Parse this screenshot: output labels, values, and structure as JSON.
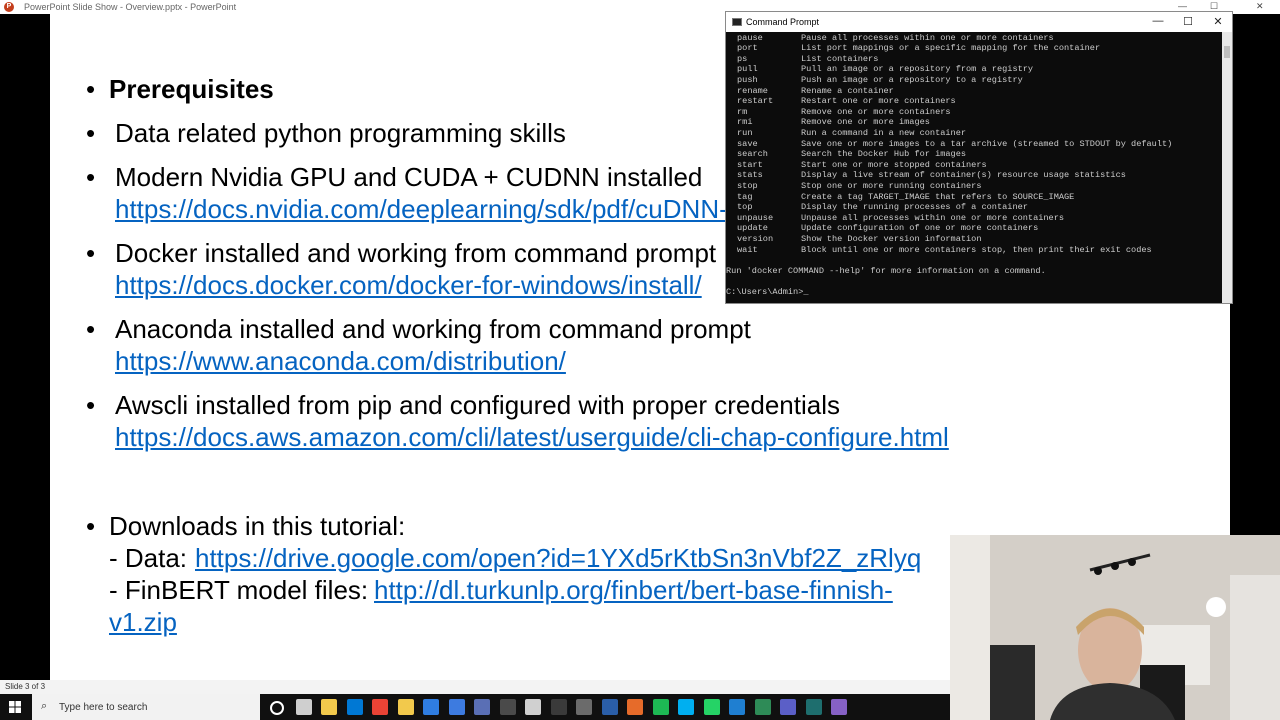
{
  "pp_titlebar": {
    "title": "PowerPoint Slide Show  -  Overview.pptx  -  PowerPoint",
    "minimize": "—",
    "maximize": "☐",
    "close": "✕"
  },
  "slide": {
    "prerequisites_heading": "Prerequisites",
    "items": [
      {
        "text": "Data related python programming skills"
      },
      {
        "text": "Modern Nvidia GPU and CUDA + CUDNN installed",
        "link": "https://docs.nvidia.com/deeplearning/sdk/pdf/cuDNN-Installation-Guide.pdf"
      },
      {
        "text": "Docker installed and working from command prompt",
        "link": "https://docs.docker.com/docker-for-windows/install/"
      },
      {
        "text": "Anaconda installed and working from command prompt",
        "link": "https://www.anaconda.com/distribution/"
      },
      {
        "text": "Awscli installed from pip and configured with proper credentials",
        "link": "https://docs.aws.amazon.com/cli/latest/userguide/cli-chap-configure.html"
      }
    ],
    "downloads_heading": "Downloads in this tutorial:",
    "data_label": "- Data: ",
    "data_link": "https://drive.google.com/open?id=1YXd5rKtbSn3nVbf2Z_zRlyq",
    "finbert_label": "- FinBERT model files: ",
    "finbert_link": "http://dl.turkunlp.org/finbert/bert-base-finnish-",
    "finbert_link_cont": "v1.zip"
  },
  "statusbar": {
    "text": "Slide 3 of 3"
  },
  "cmd": {
    "title": "Command Prompt",
    "minimize": "—",
    "maximize": "☐",
    "close": "✕",
    "commands": [
      {
        "cmd": "pause",
        "desc": "Pause all processes within one or more containers"
      },
      {
        "cmd": "port",
        "desc": "List port mappings or a specific mapping for the container"
      },
      {
        "cmd": "ps",
        "desc": "List containers"
      },
      {
        "cmd": "pull",
        "desc": "Pull an image or a repository from a registry"
      },
      {
        "cmd": "push",
        "desc": "Push an image or a repository to a registry"
      },
      {
        "cmd": "rename",
        "desc": "Rename a container"
      },
      {
        "cmd": "restart",
        "desc": "Restart one or more containers"
      },
      {
        "cmd": "rm",
        "desc": "Remove one or more containers"
      },
      {
        "cmd": "rmi",
        "desc": "Remove one or more images"
      },
      {
        "cmd": "run",
        "desc": "Run a command in a new container"
      },
      {
        "cmd": "save",
        "desc": "Save one or more images to a tar archive (streamed to STDOUT by default)"
      },
      {
        "cmd": "search",
        "desc": "Search the Docker Hub for images"
      },
      {
        "cmd": "start",
        "desc": "Start one or more stopped containers"
      },
      {
        "cmd": "stats",
        "desc": "Display a live stream of container(s) resource usage statistics"
      },
      {
        "cmd": "stop",
        "desc": "Stop one or more running containers"
      },
      {
        "cmd": "tag",
        "desc": "Create a tag TARGET_IMAGE that refers to SOURCE_IMAGE"
      },
      {
        "cmd": "top",
        "desc": "Display the running processes of a container"
      },
      {
        "cmd": "unpause",
        "desc": "Unpause all processes within one or more containers"
      },
      {
        "cmd": "update",
        "desc": "Update configuration of one or more containers"
      },
      {
        "cmd": "version",
        "desc": "Show the Docker version information"
      },
      {
        "cmd": "wait",
        "desc": "Block until one or more containers stop, then print their exit codes"
      }
    ],
    "help_line": "Run 'docker COMMAND --help' for more information on a command.",
    "prompt": "C:\\Users\\Admin>_"
  },
  "taskbar": {
    "search_placeholder": "Type here to search",
    "icons": [
      "cortana-icon",
      "task-view-icon",
      "file-explorer-icon",
      "store-icon",
      "chrome-icon",
      "folder-icon",
      "photos-icon",
      "docs-icon",
      "github-icon",
      "vpn-icon",
      "mail-icon",
      "cmd-icon",
      "window-icon",
      "powershell-icon",
      "firefox-icon",
      "spotify-icon",
      "skype-icon",
      "whatsapp-icon",
      "vscode-icon",
      "notepad-icon",
      "teams-icon",
      "terminal-icon",
      "visual-studio-icon"
    ]
  },
  "colors": {
    "link": "#0563c1",
    "terminal_bg": "#0c0c0c",
    "terminal_text": "#cccccc",
    "taskbar": "#101010"
  }
}
